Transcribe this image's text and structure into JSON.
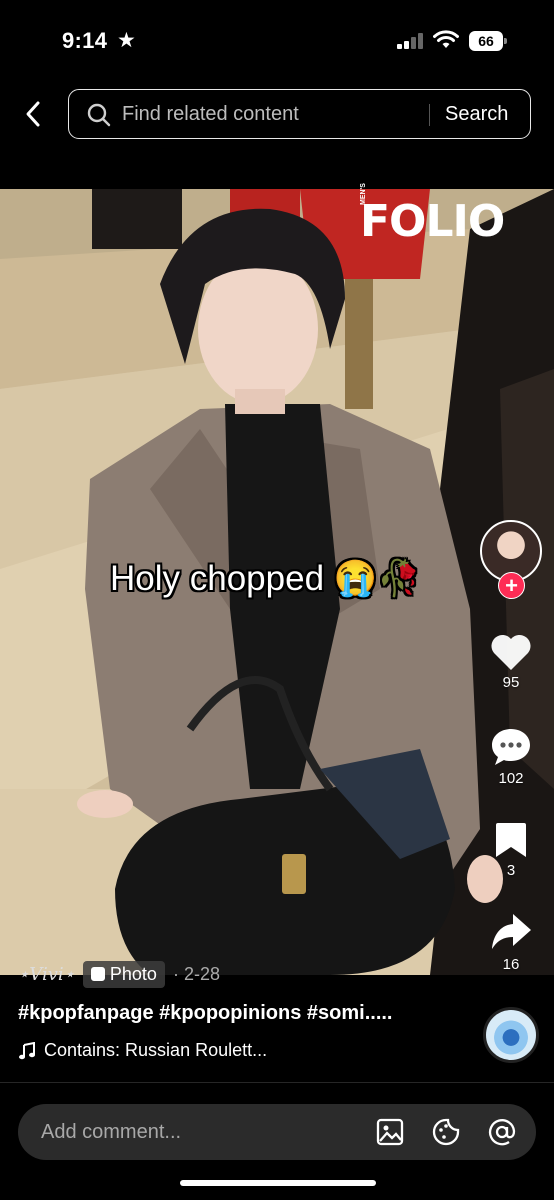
{
  "status_bar": {
    "time": "9:14",
    "battery": "66"
  },
  "search": {
    "placeholder": "Find related content",
    "button_label": "Search"
  },
  "photo": {
    "magazine_logo": "FOLIO",
    "magazine_sub": "MEN'S",
    "caption": "Holy chopped 😭🥀"
  },
  "actions": {
    "likes": "95",
    "comments": "102",
    "saves": "3",
    "shares": "16",
    "follow": "+"
  },
  "post": {
    "author_signature": "⋆Vivi⋆",
    "type_badge": "Photo",
    "date": "· 2-28",
    "hashtags": "#kpopfanpage #kpopopinions #somi.....",
    "music": "Contains: Russian Roulett..."
  },
  "comment_bar": {
    "placeholder": "Add comment..."
  },
  "colors": {
    "accent": "#fe2c55",
    "background": "#000000"
  }
}
